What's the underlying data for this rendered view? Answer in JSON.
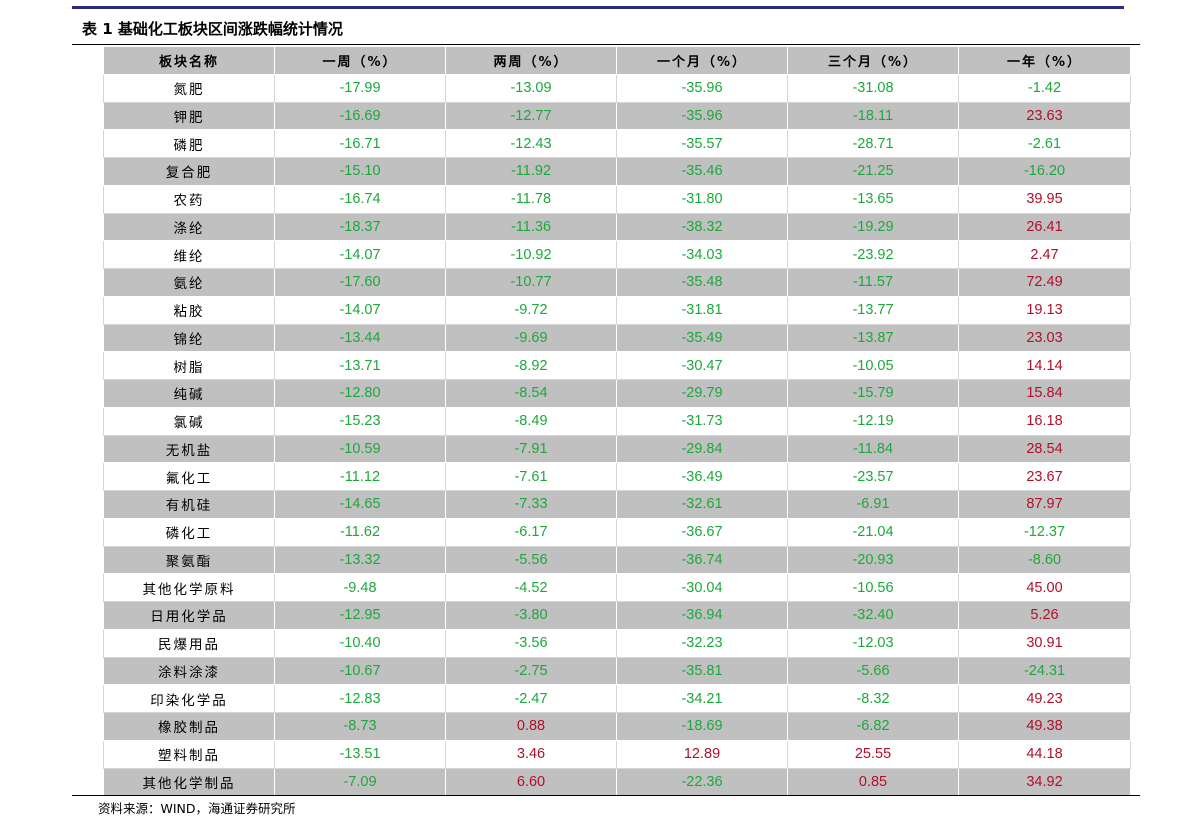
{
  "table_title": "表 1  基础化工板块区间涨跌幅统计情况",
  "columns": [
    "板块名称",
    "一周（%）",
    "两周（%）",
    "一个月（%）",
    "三个月（%）",
    "一年（%）"
  ],
  "rows": [
    {
      "name": "氮肥",
      "values": [
        "-17.99",
        "-13.09",
        "-35.96",
        "-31.08",
        "-1.42"
      ]
    },
    {
      "name": "钾肥",
      "values": [
        "-16.69",
        "-12.77",
        "-35.96",
        "-18.11",
        "23.63"
      ]
    },
    {
      "name": "磷肥",
      "values": [
        "-16.71",
        "-12.43",
        "-35.57",
        "-28.71",
        "-2.61"
      ]
    },
    {
      "name": "复合肥",
      "values": [
        "-15.10",
        "-11.92",
        "-35.46",
        "-21.25",
        "-16.20"
      ]
    },
    {
      "name": "农药",
      "values": [
        "-16.74",
        "-11.78",
        "-31.80",
        "-13.65",
        "39.95"
      ]
    },
    {
      "name": "涤纶",
      "values": [
        "-18.37",
        "-11.36",
        "-38.32",
        "-19.29",
        "26.41"
      ]
    },
    {
      "name": "维纶",
      "values": [
        "-14.07",
        "-10.92",
        "-34.03",
        "-23.92",
        "2.47"
      ]
    },
    {
      "name": "氨纶",
      "values": [
        "-17.60",
        "-10.77",
        "-35.48",
        "-11.57",
        "72.49"
      ]
    },
    {
      "name": "粘胶",
      "values": [
        "-14.07",
        "-9.72",
        "-31.81",
        "-13.77",
        "19.13"
      ]
    },
    {
      "name": "锦纶",
      "values": [
        "-13.44",
        "-9.69",
        "-35.49",
        "-13.87",
        "23.03"
      ]
    },
    {
      "name": "树脂",
      "values": [
        "-13.71",
        "-8.92",
        "-30.47",
        "-10.05",
        "14.14"
      ]
    },
    {
      "name": "纯碱",
      "values": [
        "-12.80",
        "-8.54",
        "-29.79",
        "-15.79",
        "15.84"
      ]
    },
    {
      "name": "氯碱",
      "values": [
        "-15.23",
        "-8.49",
        "-31.73",
        "-12.19",
        "16.18"
      ]
    },
    {
      "name": "无机盐",
      "values": [
        "-10.59",
        "-7.91",
        "-29.84",
        "-11.84",
        "28.54"
      ]
    },
    {
      "name": "氟化工",
      "values": [
        "-11.12",
        "-7.61",
        "-36.49",
        "-23.57",
        "23.67"
      ]
    },
    {
      "name": "有机硅",
      "values": [
        "-14.65",
        "-7.33",
        "-32.61",
        "-6.91",
        "87.97"
      ]
    },
    {
      "name": "磷化工",
      "values": [
        "-11.62",
        "-6.17",
        "-36.67",
        "-21.04",
        "-12.37"
      ]
    },
    {
      "name": "聚氨酯",
      "values": [
        "-13.32",
        "-5.56",
        "-36.74",
        "-20.93",
        "-8.60"
      ]
    },
    {
      "name": "其他化学原料",
      "values": [
        "-9.48",
        "-4.52",
        "-30.04",
        "-10.56",
        "45.00"
      ]
    },
    {
      "name": "日用化学品",
      "values": [
        "-12.95",
        "-3.80",
        "-36.94",
        "-32.40",
        "5.26"
      ]
    },
    {
      "name": "民爆用品",
      "values": [
        "-10.40",
        "-3.56",
        "-32.23",
        "-12.03",
        "30.91"
      ]
    },
    {
      "name": "涂料涂漆",
      "values": [
        "-10.67",
        "-2.75",
        "-35.81",
        "-5.66",
        "-24.31"
      ]
    },
    {
      "name": "印染化学品",
      "values": [
        "-12.83",
        "-2.47",
        "-34.21",
        "-8.32",
        "49.23"
      ]
    },
    {
      "name": "橡胶制品",
      "values": [
        "-8.73",
        "0.88",
        "-18.69",
        "-6.82",
        "49.38"
      ]
    },
    {
      "name": "塑料制品",
      "values": [
        "-13.51",
        "3.46",
        "12.89",
        "25.55",
        "44.18"
      ]
    },
    {
      "name": "其他化学制品",
      "values": [
        "-7.09",
        "6.60",
        "-22.36",
        "0.85",
        "34.92"
      ]
    }
  ],
  "colors": {
    "negative": "#1ea83c",
    "positive": "#b0102a",
    "band": "#c0c0c0",
    "rule": "#2b2a7c"
  },
  "source": "资料来源：WIND，海通证券研究所"
}
